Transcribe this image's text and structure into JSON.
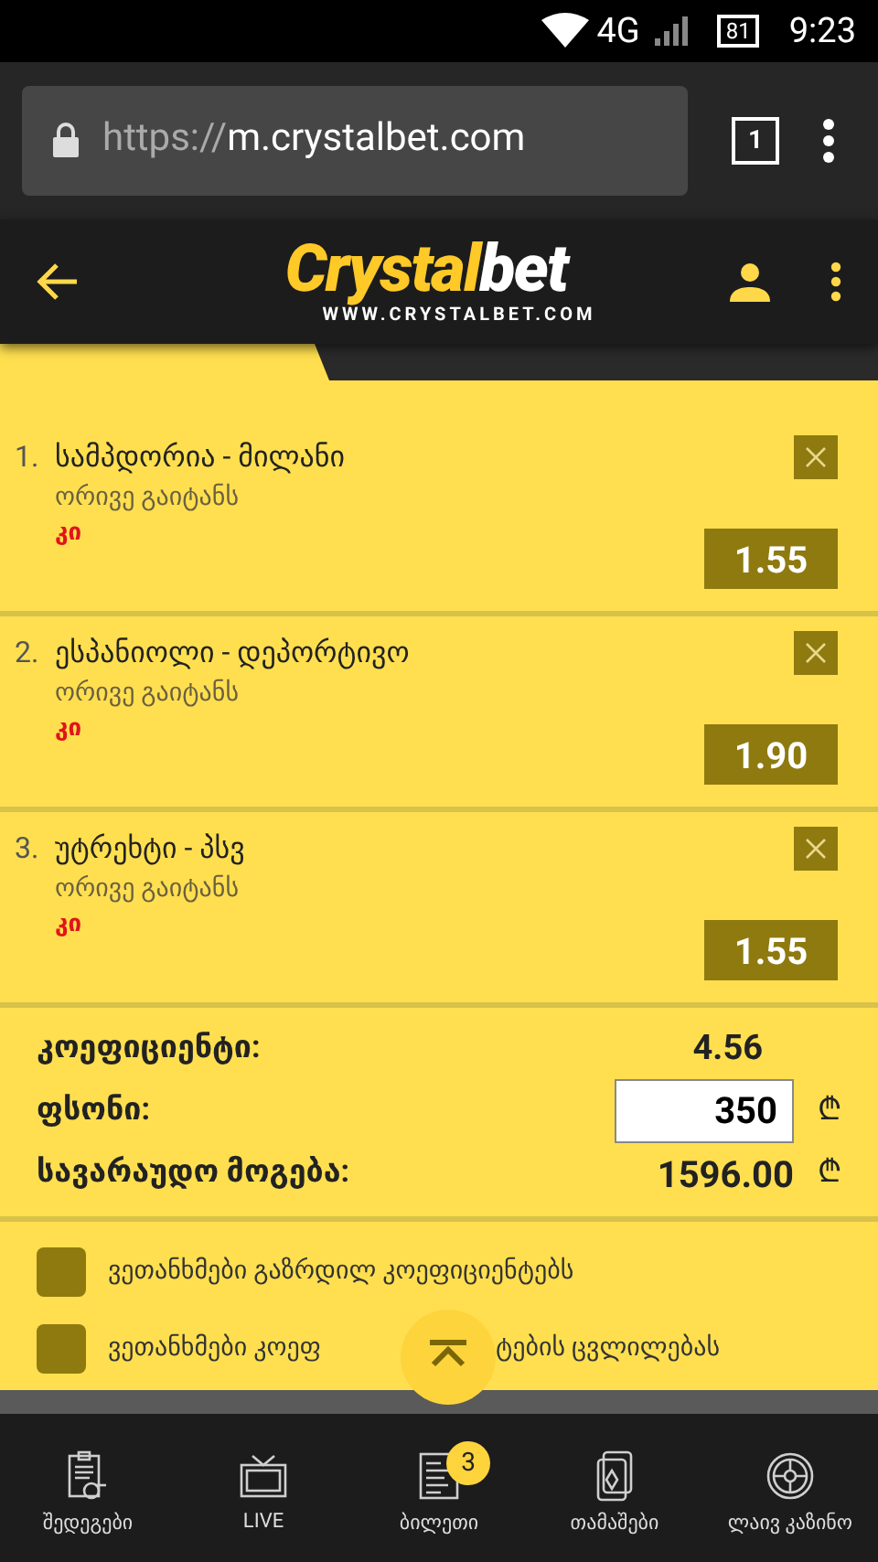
{
  "status_bar": {
    "network": "4G",
    "battery": "81",
    "time": "9:23"
  },
  "browser": {
    "url_scheme": "https://",
    "url_host": "m.crystalbet.com",
    "tab_count": "1"
  },
  "header": {
    "logo_main": "Crystal",
    "logo_accent": "bet",
    "logo_url": "WWW.CRYSTALBET.COM"
  },
  "bets": [
    {
      "number": "1.",
      "match": "სამპდორია - მილანი",
      "market": "ორივე გაიტანს",
      "pick": "კი",
      "odds": "1.55"
    },
    {
      "number": "2.",
      "match": "ესპანიოლი - დეპორტივო",
      "market": "ორივე გაიტანს",
      "pick": "კი",
      "odds": "1.90"
    },
    {
      "number": "3.",
      "match": "უტრეხტი - პსვ",
      "market": "ორივე გაიტანს",
      "pick": "კი",
      "odds": "1.55"
    }
  ],
  "summary": {
    "odds_label": "კოეფიციენტი:",
    "odds_value": "4.56",
    "stake_label": "ფსონი:",
    "stake_value": "350",
    "currency": "₾",
    "win_label": "სავარაუდო მოგება:",
    "win_value": "1596.00"
  },
  "agreements": [
    {
      "label": "ვეთანხმები გაზრდილ კოეფიციენტებს",
      "checked": false
    },
    {
      "label": "ვეთანხმები კოეფ",
      "label_end": "ტების ცვლილებას",
      "checked": false
    }
  ],
  "bottom_nav": [
    {
      "label": "შედეგები",
      "kind": "results"
    },
    {
      "label": "LIVE",
      "kind": "live"
    },
    {
      "label": "ბილეთი",
      "kind": "ticket",
      "badge": "3"
    },
    {
      "label": "თამაშები",
      "kind": "games"
    },
    {
      "label": "ლაივ კაზინო",
      "kind": "casino"
    }
  ]
}
